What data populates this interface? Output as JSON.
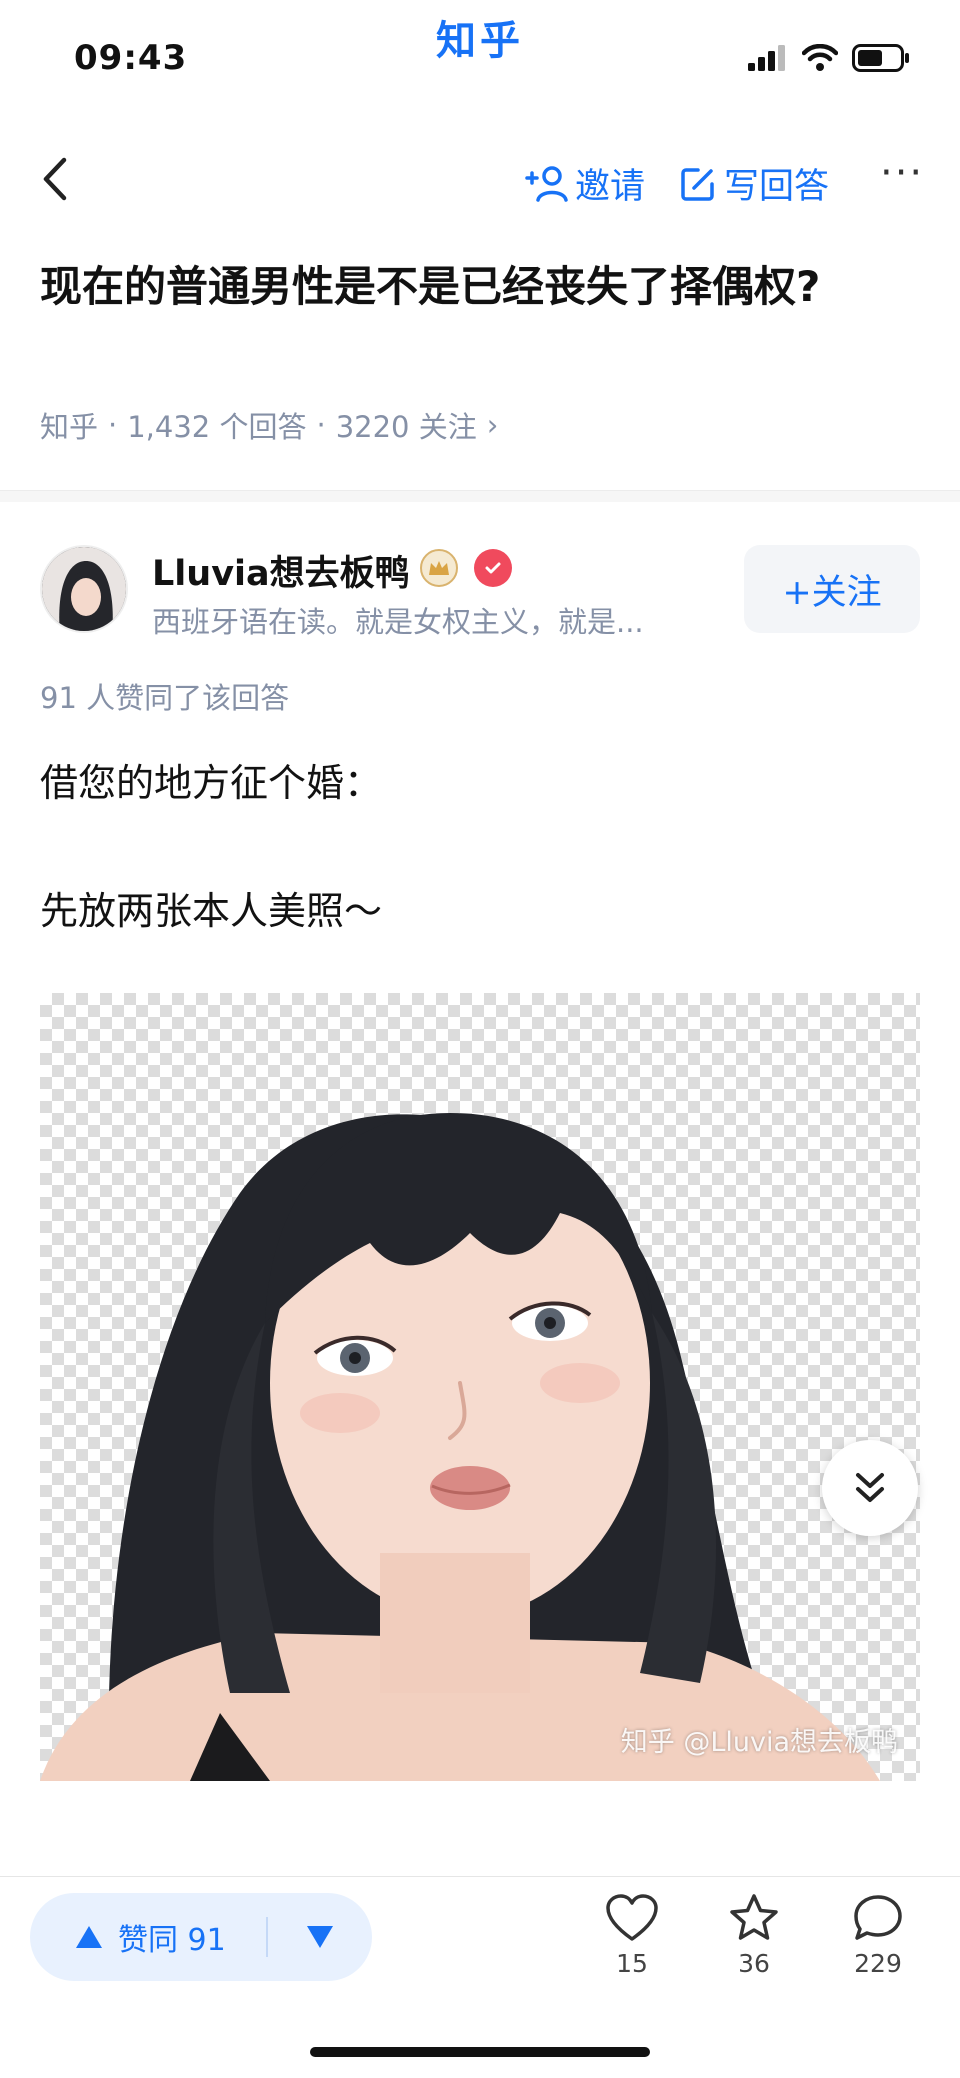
{
  "status_bar": {
    "time": "09:43",
    "app_name": "知乎",
    "battery_level": 0.6
  },
  "nav": {
    "invite_label": "邀请",
    "write_label": "写回答",
    "more_label": "···"
  },
  "question": {
    "title": "现在的普通男性是不是已经丧失了择偶权?",
    "source": "知乎",
    "answers": "1,432 个回答",
    "followers": "3220 关注",
    "chevron": "›"
  },
  "author": {
    "name": "Lluvia想去板鸭",
    "bio": "西班牙语在读。就是女权主义，就是...",
    "follow_label": "+关注"
  },
  "answer": {
    "agree_text": "91 人赞同了该回答",
    "paragraphs": [
      "借您的地方征个婚：",
      "先放两张本人美照～"
    ],
    "image_watermark": "知乎 @Lluvia想去板鸭"
  },
  "bottom_bar": {
    "vote_label": "赞同 91",
    "likes": "15",
    "favorites": "36",
    "comments": "229"
  },
  "colors": {
    "accent": "#1772f6",
    "meta": "#8590a6",
    "vote_bg": "#e8f1fe"
  },
  "icons": [
    "back-icon",
    "invite-user-icon",
    "edit-icon",
    "heart-icon",
    "star-icon",
    "comment-icon",
    "arrow-up-icon",
    "arrow-down-icon",
    "double-chevron-down-icon"
  ]
}
